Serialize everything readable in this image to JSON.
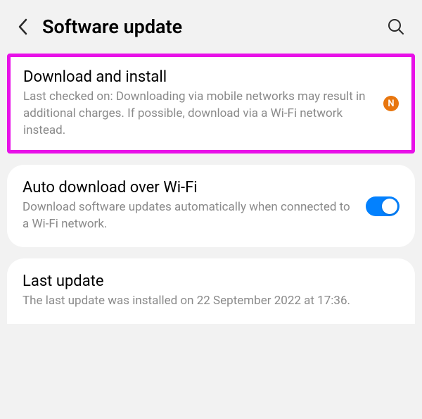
{
  "header": {
    "title": "Software update"
  },
  "cards": {
    "download": {
      "title": "Download and install",
      "subtitle": "Last checked on:\nDownloading via mobile networks may result in additional charges. If possible, download via a Wi-Fi network instead.",
      "badge_letter": "N",
      "badge_color": "#e8760e"
    },
    "auto_download": {
      "title": "Auto download over Wi-Fi",
      "subtitle": "Download software updates automatically when connected to a Wi-Fi network.",
      "toggle_on": true,
      "toggle_color": "#0381fe"
    },
    "last_update": {
      "title": "Last update",
      "subtitle": "The last update was installed on 22 September 2022 at 17:36."
    }
  }
}
